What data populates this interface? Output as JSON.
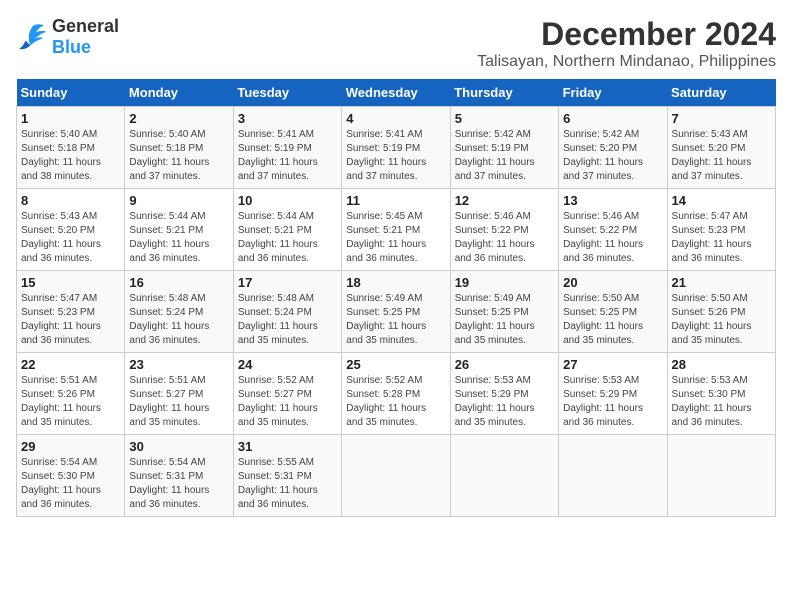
{
  "header": {
    "logo_line1": "General",
    "logo_line2": "Blue",
    "month": "December 2024",
    "location": "Talisayan, Northern Mindanao, Philippines"
  },
  "weekdays": [
    "Sunday",
    "Monday",
    "Tuesday",
    "Wednesday",
    "Thursday",
    "Friday",
    "Saturday"
  ],
  "weeks": [
    [
      {
        "day": "1",
        "info": "Sunrise: 5:40 AM\nSunset: 5:18 PM\nDaylight: 11 hours\nand 38 minutes."
      },
      {
        "day": "2",
        "info": "Sunrise: 5:40 AM\nSunset: 5:18 PM\nDaylight: 11 hours\nand 37 minutes."
      },
      {
        "day": "3",
        "info": "Sunrise: 5:41 AM\nSunset: 5:19 PM\nDaylight: 11 hours\nand 37 minutes."
      },
      {
        "day": "4",
        "info": "Sunrise: 5:41 AM\nSunset: 5:19 PM\nDaylight: 11 hours\nand 37 minutes."
      },
      {
        "day": "5",
        "info": "Sunrise: 5:42 AM\nSunset: 5:19 PM\nDaylight: 11 hours\nand 37 minutes."
      },
      {
        "day": "6",
        "info": "Sunrise: 5:42 AM\nSunset: 5:20 PM\nDaylight: 11 hours\nand 37 minutes."
      },
      {
        "day": "7",
        "info": "Sunrise: 5:43 AM\nSunset: 5:20 PM\nDaylight: 11 hours\nand 37 minutes."
      }
    ],
    [
      {
        "day": "8",
        "info": "Sunrise: 5:43 AM\nSunset: 5:20 PM\nDaylight: 11 hours\nand 36 minutes."
      },
      {
        "day": "9",
        "info": "Sunrise: 5:44 AM\nSunset: 5:21 PM\nDaylight: 11 hours\nand 36 minutes."
      },
      {
        "day": "10",
        "info": "Sunrise: 5:44 AM\nSunset: 5:21 PM\nDaylight: 11 hours\nand 36 minutes."
      },
      {
        "day": "11",
        "info": "Sunrise: 5:45 AM\nSunset: 5:21 PM\nDaylight: 11 hours\nand 36 minutes."
      },
      {
        "day": "12",
        "info": "Sunrise: 5:46 AM\nSunset: 5:22 PM\nDaylight: 11 hours\nand 36 minutes."
      },
      {
        "day": "13",
        "info": "Sunrise: 5:46 AM\nSunset: 5:22 PM\nDaylight: 11 hours\nand 36 minutes."
      },
      {
        "day": "14",
        "info": "Sunrise: 5:47 AM\nSunset: 5:23 PM\nDaylight: 11 hours\nand 36 minutes."
      }
    ],
    [
      {
        "day": "15",
        "info": "Sunrise: 5:47 AM\nSunset: 5:23 PM\nDaylight: 11 hours\nand 36 minutes."
      },
      {
        "day": "16",
        "info": "Sunrise: 5:48 AM\nSunset: 5:24 PM\nDaylight: 11 hours\nand 36 minutes."
      },
      {
        "day": "17",
        "info": "Sunrise: 5:48 AM\nSunset: 5:24 PM\nDaylight: 11 hours\nand 35 minutes."
      },
      {
        "day": "18",
        "info": "Sunrise: 5:49 AM\nSunset: 5:25 PM\nDaylight: 11 hours\nand 35 minutes."
      },
      {
        "day": "19",
        "info": "Sunrise: 5:49 AM\nSunset: 5:25 PM\nDaylight: 11 hours\nand 35 minutes."
      },
      {
        "day": "20",
        "info": "Sunrise: 5:50 AM\nSunset: 5:25 PM\nDaylight: 11 hours\nand 35 minutes."
      },
      {
        "day": "21",
        "info": "Sunrise: 5:50 AM\nSunset: 5:26 PM\nDaylight: 11 hours\nand 35 minutes."
      }
    ],
    [
      {
        "day": "22",
        "info": "Sunrise: 5:51 AM\nSunset: 5:26 PM\nDaylight: 11 hours\nand 35 minutes."
      },
      {
        "day": "23",
        "info": "Sunrise: 5:51 AM\nSunset: 5:27 PM\nDaylight: 11 hours\nand 35 minutes."
      },
      {
        "day": "24",
        "info": "Sunrise: 5:52 AM\nSunset: 5:27 PM\nDaylight: 11 hours\nand 35 minutes."
      },
      {
        "day": "25",
        "info": "Sunrise: 5:52 AM\nSunset: 5:28 PM\nDaylight: 11 hours\nand 35 minutes."
      },
      {
        "day": "26",
        "info": "Sunrise: 5:53 AM\nSunset: 5:29 PM\nDaylight: 11 hours\nand 35 minutes."
      },
      {
        "day": "27",
        "info": "Sunrise: 5:53 AM\nSunset: 5:29 PM\nDaylight: 11 hours\nand 36 minutes."
      },
      {
        "day": "28",
        "info": "Sunrise: 5:53 AM\nSunset: 5:30 PM\nDaylight: 11 hours\nand 36 minutes."
      }
    ],
    [
      {
        "day": "29",
        "info": "Sunrise: 5:54 AM\nSunset: 5:30 PM\nDaylight: 11 hours\nand 36 minutes."
      },
      {
        "day": "30",
        "info": "Sunrise: 5:54 AM\nSunset: 5:31 PM\nDaylight: 11 hours\nand 36 minutes."
      },
      {
        "day": "31",
        "info": "Sunrise: 5:55 AM\nSunset: 5:31 PM\nDaylight: 11 hours\nand 36 minutes."
      },
      {
        "day": "",
        "info": ""
      },
      {
        "day": "",
        "info": ""
      },
      {
        "day": "",
        "info": ""
      },
      {
        "day": "",
        "info": ""
      }
    ]
  ]
}
